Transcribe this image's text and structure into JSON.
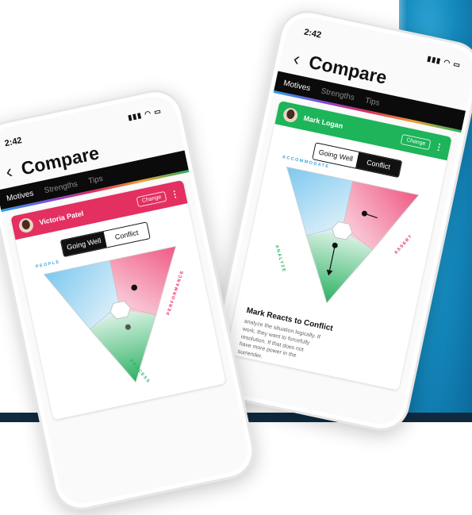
{
  "colors": {
    "victoria": "#e42f61",
    "mark": "#1db45a",
    "people": "#3aa6dd",
    "performance": "#e42f61",
    "process": "#2bb163"
  },
  "left_phone": {
    "status_time": "2:42",
    "status_icons": "signal-wifi-battery",
    "title": "Compare",
    "tabs": [
      "Motives",
      "Strengths",
      "Tips"
    ],
    "person_name": "Victoria Patel",
    "change_label": "Change",
    "toggle": [
      "Going Well",
      "Conflict"
    ],
    "axis_labels": {
      "top_left": "PEOPLE",
      "right": "PERFORMANCE",
      "bottom": "PROCESS"
    }
  },
  "right_phone": {
    "status_time": "2:42",
    "title": "Compare",
    "tabs": [
      "Motives",
      "Strengths",
      "Tips"
    ],
    "person_name": "Mark Logan",
    "change_label": "Change",
    "toggle": [
      "Going Well",
      "Conflict"
    ],
    "axis_labels": {
      "top_left": "ACCOMMODATE",
      "right": "ASSERT",
      "left": "ANALYZE"
    },
    "section_title": "Mark Reacts to Conflict",
    "section_lines": [
      "analyze the situation logically. If",
      "work, they want to forcefully",
      "resolution. If that does not",
      "have more power in the",
      "surrender."
    ]
  }
}
